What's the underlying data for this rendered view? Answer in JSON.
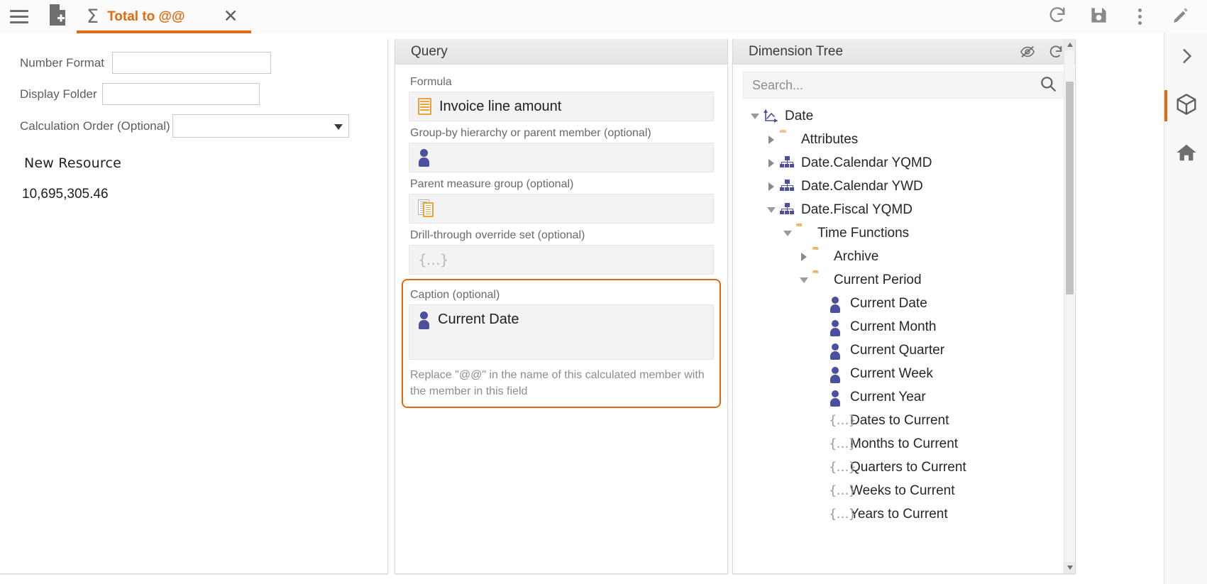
{
  "toolbar": {
    "menu_icon": "hamburger-menu-icon",
    "new_doc_icon": "new-document-icon",
    "tab": {
      "sigma": "Σ",
      "title": "Total to @@",
      "close": "✕"
    },
    "refresh_icon": "refresh-icon",
    "save_icon": "save-icon",
    "more_icon": "kebab-menu-icon",
    "edit_icon": "pencil-edit-icon"
  },
  "left_panel": {
    "fields": [
      {
        "label": "Number Format",
        "value": "",
        "placeholder": ""
      },
      {
        "label": "Display Folder",
        "value": "",
        "placeholder": ""
      },
      {
        "label": "Calculation Order (Optional)",
        "value": "",
        "placeholder": ""
      }
    ],
    "resource_name": "New Resource",
    "resource_value": "10,695,305.46"
  },
  "query_panel": {
    "title": "Query",
    "fields": [
      {
        "label": "Formula",
        "value": "Invoice line amount",
        "icon": "measure-icon"
      },
      {
        "label": "Group-by hierarchy or parent member (optional)",
        "value": "",
        "icon": "member-icon"
      },
      {
        "label": "Parent measure group (optional)",
        "value": "",
        "icon": "measure-group-icon"
      },
      {
        "label": "Drill-through override set (optional)",
        "value": "",
        "icon": "set-icon"
      }
    ],
    "caption": {
      "label": "Caption (optional)",
      "value": "Current Date",
      "icon": "member-icon",
      "hint": "Replace \"@@\" in the name of this calculated member with the member in this field"
    }
  },
  "tree_panel": {
    "title": "Dimension Tree",
    "hide_icon": "eye-slash-icon",
    "refresh_icon": "refresh-icon",
    "search": {
      "placeholder": "Search...",
      "value": "",
      "icon": "search-icon"
    },
    "items": [
      {
        "label": "Date",
        "depth": 0,
        "state": "expanded",
        "icon": "dimension-axes-icon"
      },
      {
        "label": "Attributes",
        "depth": 1,
        "state": "collapsed",
        "icon": "attributes-folder-icon"
      },
      {
        "label": "Date.Calendar YQMD",
        "depth": 1,
        "state": "collapsed",
        "icon": "hierarchy-icon"
      },
      {
        "label": "Date.Calendar YWD",
        "depth": 1,
        "state": "collapsed",
        "icon": "hierarchy-icon"
      },
      {
        "label": "Date.Fiscal YQMD",
        "depth": 1,
        "state": "expanded",
        "icon": "hierarchy-icon"
      },
      {
        "label": "Time Functions",
        "depth": 2,
        "state": "expanded",
        "icon": "function-folder-icon"
      },
      {
        "label": "Archive",
        "depth": 3,
        "state": "collapsed",
        "icon": "function-folder-icon"
      },
      {
        "label": "Current Period",
        "depth": 3,
        "state": "expanded",
        "icon": "function-folder-icon"
      },
      {
        "label": "Current Date",
        "depth": 4,
        "state": "leaf",
        "icon": "member-icon"
      },
      {
        "label": "Current Month",
        "depth": 4,
        "state": "leaf",
        "icon": "member-icon"
      },
      {
        "label": "Current Quarter",
        "depth": 4,
        "state": "leaf",
        "icon": "member-icon"
      },
      {
        "label": "Current Week",
        "depth": 4,
        "state": "leaf",
        "icon": "member-icon"
      },
      {
        "label": "Current Year",
        "depth": 4,
        "state": "leaf",
        "icon": "member-icon"
      },
      {
        "label": "Dates to Current",
        "depth": 4,
        "state": "leaf",
        "icon": "set-icon"
      },
      {
        "label": "Months to Current",
        "depth": 4,
        "state": "leaf",
        "icon": "set-icon"
      },
      {
        "label": "Quarters to Current",
        "depth": 4,
        "state": "leaf",
        "icon": "set-icon"
      },
      {
        "label": "Weeks to Current",
        "depth": 4,
        "state": "leaf",
        "icon": "set-icon"
      },
      {
        "label": "Years to Current",
        "depth": 4,
        "state": "leaf",
        "icon": "set-icon"
      }
    ]
  },
  "rail": {
    "buttons": [
      {
        "icon": "chevron-right-icon",
        "active": false
      },
      {
        "icon": "cube-model-icon",
        "active": true
      },
      {
        "icon": "home-icon",
        "active": false
      }
    ]
  },
  "colors": {
    "accent": "#e2690f",
    "member_blue": "#4a4f9e",
    "folder_gold": "#e8b35e",
    "panel_header": "#e7e7e7"
  }
}
